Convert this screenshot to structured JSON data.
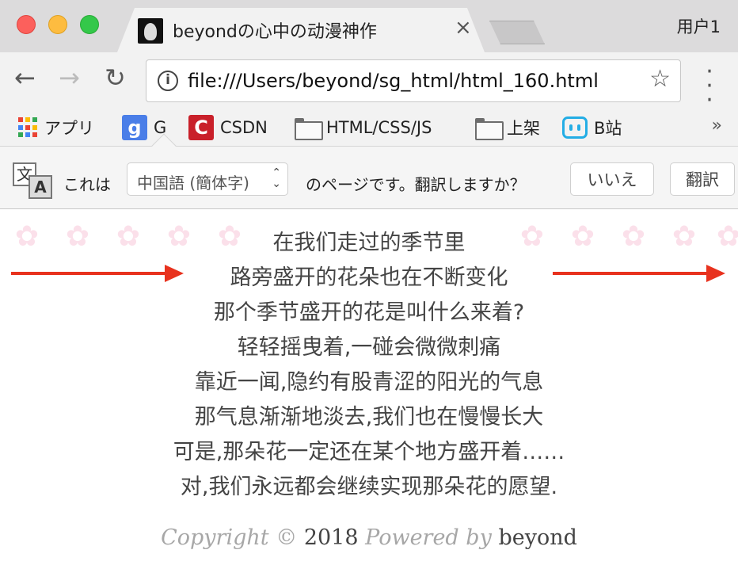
{
  "window": {
    "tab_title": "beyondの心中の动漫神作",
    "tab_close": "×",
    "profile": "用户1"
  },
  "toolbar": {
    "back": "←",
    "forward": "→",
    "reload": "↻",
    "url": "file:///Users/beyond/sg_html/html_160.html",
    "bookmark_star": "☆",
    "menu": "⋮"
  },
  "bookmarks": {
    "items": [
      {
        "label": "アプリ",
        "icon": "apps-grid-icon"
      },
      {
        "label": "G",
        "icon": "google-icon",
        "icon_text": "g"
      },
      {
        "label": "CSDN",
        "icon": "csdn-icon",
        "icon_text": "C"
      },
      {
        "label": "HTML/CSS/JS",
        "icon": "folder-icon"
      },
      {
        "label": "上架",
        "icon": "folder-icon"
      },
      {
        "label": "B站",
        "icon": "bilibili-icon"
      }
    ],
    "more": "»",
    "apps_colors": [
      "#ea4335",
      "#fbbc05",
      "#34a853",
      "#4285f4",
      "#ea4335",
      "#fbbc05",
      "#34a853",
      "#4285f4",
      "#ea4335"
    ]
  },
  "translate": {
    "icon_back": "文",
    "icon_front": "A",
    "prefix": "これは",
    "language": "中国語 (簡体字)",
    "suffix": "のページです。翻訳しますか？",
    "no_label": "いいえ",
    "yes_label": "翻訳"
  },
  "poem": {
    "lines": [
      "在我们走过的季节里",
      "路旁盛开的花朵也在不断变化",
      "那个季节盛开的花是叫什么来着?",
      "轻轻摇曳着,一碰会微微刺痛",
      "靠近一闻,隐约有股青涩的阳光的气息",
      "那气息渐渐地淡去,我们也在慢慢长大",
      "可是,那朵花一定还在某个地方盛开着……",
      "对,我们永远都会继续实现那朵花的愿望."
    ]
  },
  "footer": {
    "copyright": "Copyright ©",
    "year": "2018",
    "powered_by": "Powered by",
    "author": "beyond"
  },
  "colors": {
    "arrow": "#e8321e",
    "flower": "#fbe0ea",
    "text": "#444444"
  }
}
